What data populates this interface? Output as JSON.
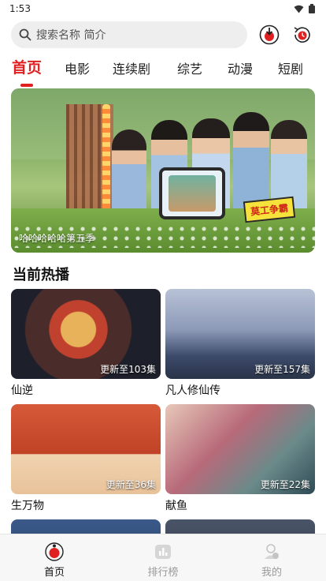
{
  "status_bar": {
    "time": "1:53"
  },
  "search": {
    "placeholder": "搜索名称 简介"
  },
  "tabs": [
    {
      "label": "首页",
      "active": true
    },
    {
      "label": "电影"
    },
    {
      "label": "连续剧"
    },
    {
      "label": "综艺"
    },
    {
      "label": "动漫"
    },
    {
      "label": "短剧"
    }
  ],
  "banner": {
    "caption": "哈哈哈哈哈第五季",
    "sticker_text": "莫工争霸"
  },
  "section": {
    "title": "当前热播"
  },
  "cards": [
    {
      "title": "仙逆",
      "badge": "更新至103集"
    },
    {
      "title": "凡人修仙传",
      "badge": "更新至157集"
    },
    {
      "title": "生万物",
      "badge": "更新至36集"
    },
    {
      "title": "献鱼",
      "badge": "更新至22集"
    },
    {
      "title": "",
      "badge": ""
    },
    {
      "title": "",
      "badge": ""
    }
  ],
  "bottom_nav": [
    {
      "label": "首页",
      "icon": "home-icon",
      "active": true
    },
    {
      "label": "排行榜",
      "icon": "ranking-icon"
    },
    {
      "label": "我的",
      "icon": "profile-icon"
    }
  ],
  "colors": {
    "accent": "#e02020",
    "search_bg": "#eeeeee",
    "nav_bg": "#f7f7f7"
  }
}
